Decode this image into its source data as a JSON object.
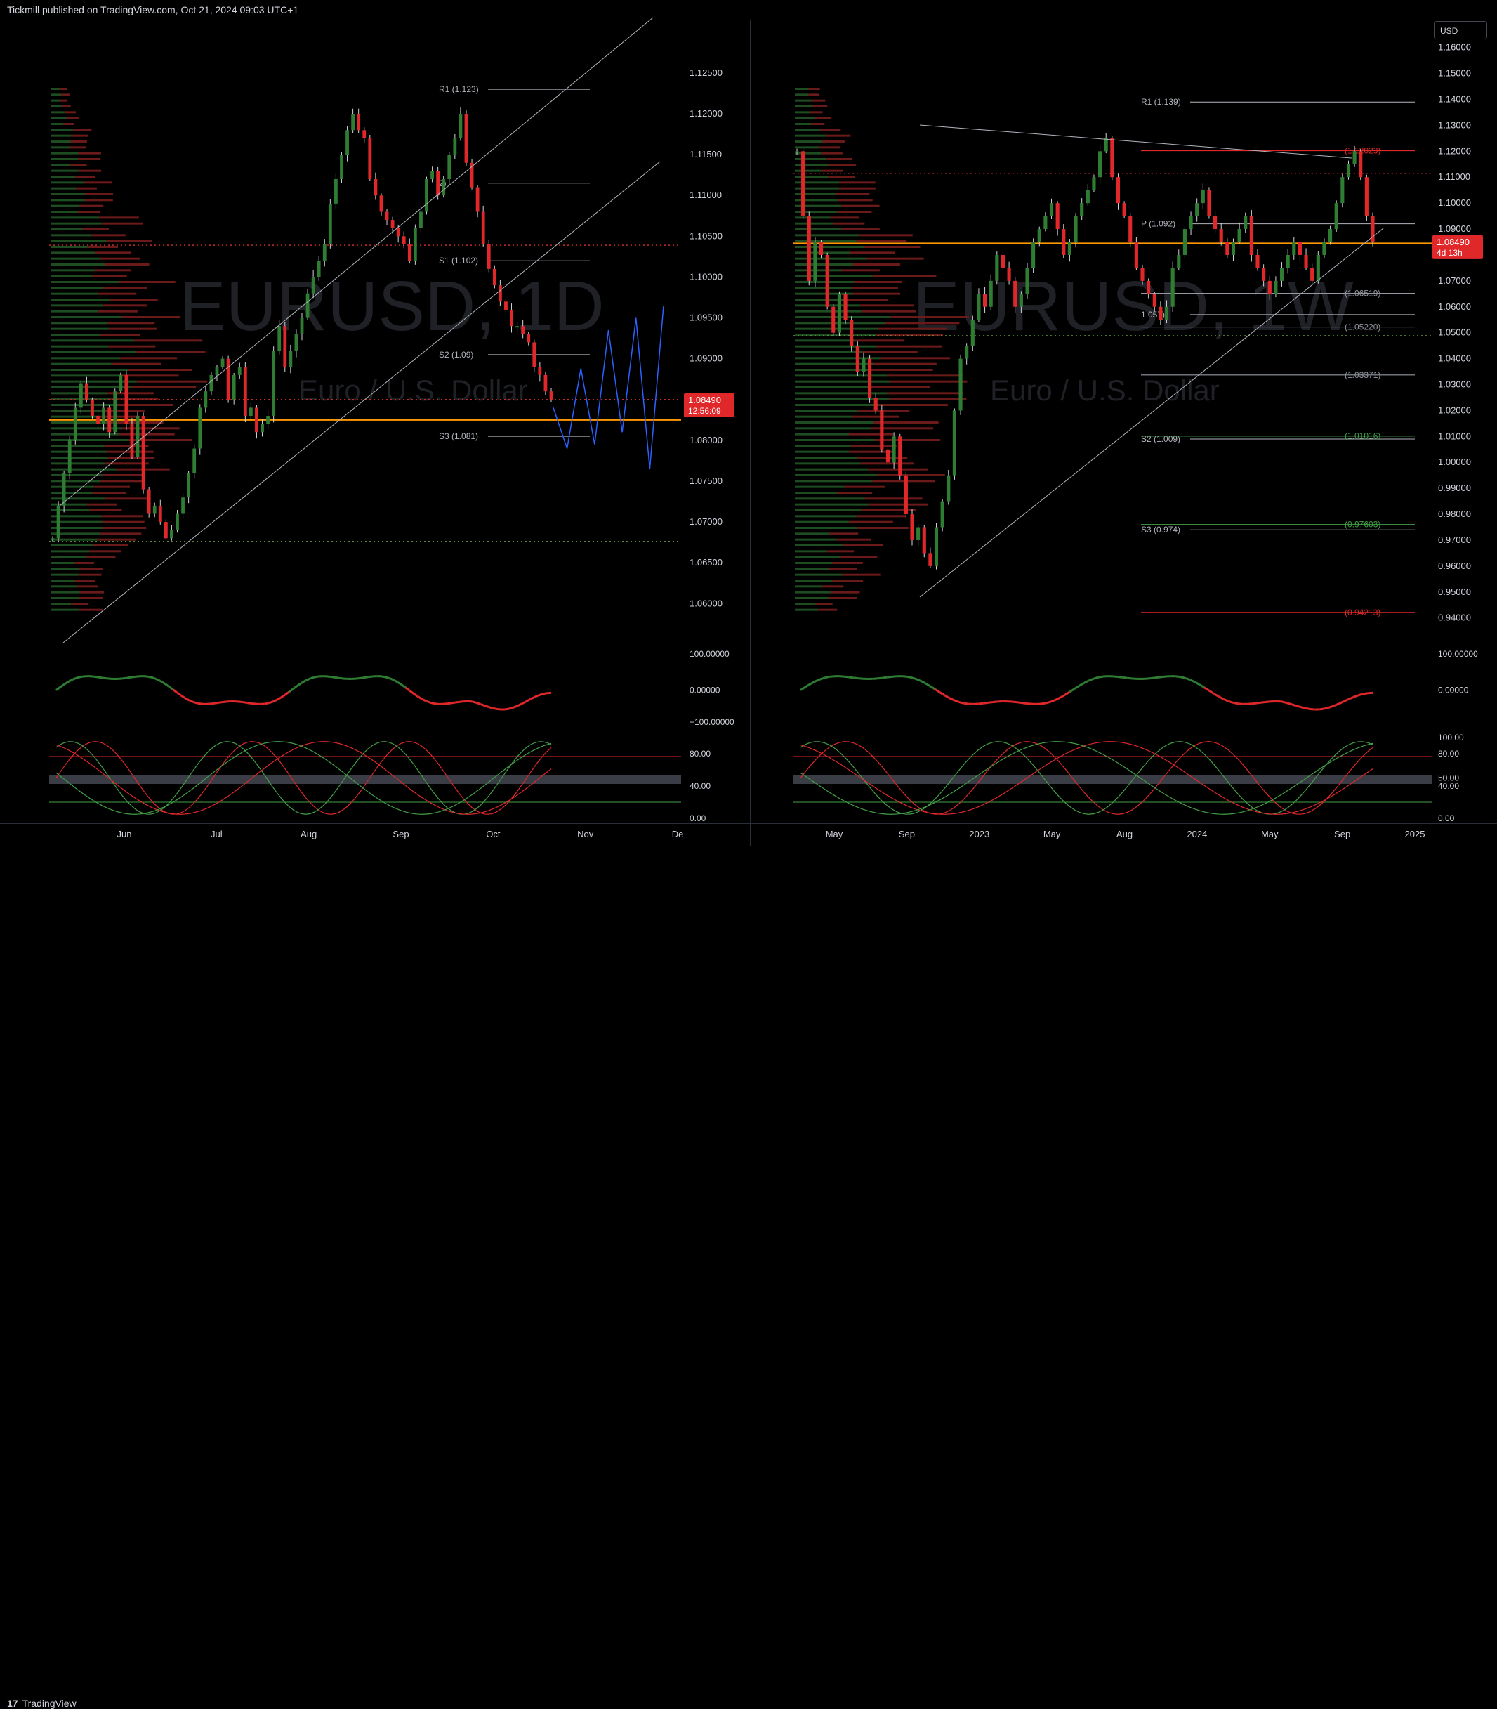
{
  "header": {
    "publisher": "Tickmill published on TradingView.com, Oct 21, 2024 09:03 UTC+1"
  },
  "footer": {
    "brand": "TradingView",
    "brand_mark": "17"
  },
  "currency_selector": "USD",
  "colors": {
    "up": "#2e7d32",
    "down": "#e0282b",
    "orange": "#ff9800",
    "background": "#000000",
    "grid": "#1a1a1a"
  },
  "chart_data": [
    {
      "type": "line",
      "panel": "left",
      "symbol_watermark": "EURUSD, 1D",
      "name_watermark": "Euro / U.S. Dollar",
      "price_axis": [
        "1.12500",
        "1.12000",
        "1.11500",
        "1.11000",
        "1.10500",
        "1.10000",
        "1.09500",
        "1.09000",
        "1.08500",
        "1.08000",
        "1.07500",
        "1.07000",
        "1.06500",
        "1.06000"
      ],
      "ylim": [
        1.0565,
        1.1305
      ],
      "time_axis": [
        "Jun",
        "Jul",
        "Aug",
        "Sep",
        "Oct",
        "Nov",
        "De"
      ],
      "last_price": "1.08490",
      "countdown": "12:56:09",
      "pivot_labels": [
        {
          "label": "R1 (1.123)",
          "value": 1.123
        },
        {
          "label": "2)",
          "value": 1.1115
        },
        {
          "label": "S1 (1.102)",
          "value": 1.102
        },
        {
          "label": "S2 (1.09)",
          "value": 1.0905
        },
        {
          "label": "S3 (1.081)",
          "value": 1.0805
        }
      ],
      "horizontal_lines": {
        "orange": 1.0825,
        "red_dotted": [
          1.1039,
          1.085
        ],
        "green_dotted": 1.0676
      },
      "close_series": [
        1.068,
        1.072,
        1.076,
        1.08,
        1.084,
        1.087,
        1.085,
        1.083,
        1.082,
        1.084,
        1.081,
        1.086,
        1.088,
        1.082,
        1.078,
        1.083,
        1.074,
        1.071,
        1.072,
        1.07,
        1.068,
        1.069,
        1.071,
        1.073,
        1.076,
        1.079,
        1.084,
        1.086,
        1.088,
        1.089,
        1.09,
        1.085,
        1.088,
        1.089,
        1.083,
        1.084,
        1.081,
        1.082,
        1.083,
        1.091,
        1.094,
        1.089,
        1.091,
        1.093,
        1.095,
        1.098,
        1.1,
        1.102,
        1.104,
        1.109,
        1.112,
        1.115,
        1.118,
        1.12,
        1.118,
        1.117,
        1.112,
        1.11,
        1.108,
        1.107,
        1.106,
        1.105,
        1.104,
        1.102,
        1.106,
        1.108,
        1.112,
        1.113,
        1.11,
        1.112,
        1.115,
        1.117,
        1.12,
        1.114,
        1.111,
        1.108,
        1.104,
        1.101,
        1.099,
        1.097,
        1.096,
        1.094,
        1.094,
        1.093,
        1.092,
        1.089,
        1.088,
        1.086,
        1.085
      ],
      "projection_path": [
        1.084,
        1.079,
        1.0888,
        1.0795,
        1.0935,
        1.081,
        1.095,
        1.0765,
        1.0965
      ],
      "oscillator_axis": [
        "100.00000",
        "0.00000",
        "−100.00000"
      ],
      "stoch_axis": [
        "80.00",
        "40.00",
        "0.00"
      ]
    },
    {
      "type": "line",
      "panel": "right",
      "symbol_watermark": "EURUSD, 1W",
      "name_watermark": "Euro / U.S. Dollar",
      "price_axis": [
        "1.16000",
        "1.15000",
        "1.14000",
        "1.13000",
        "1.12000",
        "1.11000",
        "1.10000",
        "1.09000",
        "1.08000",
        "1.07000",
        "1.06000",
        "1.05000",
        "1.04000",
        "1.03000",
        "1.02000",
        "1.01000",
        "1.00000",
        "0.99000",
        "0.98000",
        "0.97000",
        "0.96000",
        "0.95000",
        "0.94000"
      ],
      "ylim": [
        0.9345,
        1.1675
      ],
      "time_axis": [
        "May",
        "Sep",
        "2023",
        "May",
        "Aug",
        "2024",
        "May",
        "Sep",
        "2025"
      ],
      "last_price": "1.08490",
      "countdown": "4d 13h",
      "pivot_labels": [
        {
          "label": "R1 (1.139)",
          "value": 1.139
        },
        {
          "label": "P (1.092)",
          "value": 1.092
        },
        {
          "label": "1.057)",
          "value": 1.057
        },
        {
          "label": "S2 (1.009)",
          "value": 1.009
        },
        {
          "label": "S3 (0.974)",
          "value": 0.974
        }
      ],
      "fib_labels": [
        {
          "label": "(1.12023)",
          "value": 1.12023
        },
        {
          "label": "(1.06519)",
          "value": 1.06519
        },
        {
          "label": "(1.05220)",
          "value": 1.0522
        },
        {
          "label": "(1.03371)",
          "value": 1.03371
        },
        {
          "label": "(1.01016)",
          "value": 1.01016
        },
        {
          "label": "(0.97603)",
          "value": 0.97603
        },
        {
          "label": "(0.94213)",
          "value": 0.94213
        }
      ],
      "horizontal_lines": {
        "orange": 1.0845,
        "red_dotted": 1.1115,
        "green_dotted": 1.0488
      },
      "close_series": [
        1.12,
        1.095,
        1.07,
        1.085,
        1.08,
        1.06,
        1.05,
        1.065,
        1.055,
        1.045,
        1.035,
        1.04,
        1.025,
        1.02,
        1.005,
        1.0,
        1.01,
        0.995,
        0.98,
        0.97,
        0.975,
        0.965,
        0.96,
        0.975,
        0.985,
        0.995,
        1.02,
        1.04,
        1.045,
        1.055,
        1.065,
        1.06,
        1.07,
        1.08,
        1.075,
        1.07,
        1.06,
        1.065,
        1.075,
        1.085,
        1.09,
        1.095,
        1.1,
        1.09,
        1.08,
        1.085,
        1.095,
        1.1,
        1.105,
        1.11,
        1.12,
        1.125,
        1.11,
        1.1,
        1.095,
        1.085,
        1.075,
        1.07,
        1.065,
        1.06,
        1.055,
        1.06,
        1.075,
        1.08,
        1.09,
        1.095,
        1.1,
        1.105,
        1.095,
        1.09,
        1.085,
        1.08,
        1.085,
        1.09,
        1.095,
        1.08,
        1.075,
        1.07,
        1.065,
        1.07,
        1.075,
        1.08,
        1.085,
        1.08,
        1.075,
        1.07,
        1.08,
        1.085,
        1.09,
        1.1,
        1.11,
        1.115,
        1.12,
        1.11,
        1.095,
        1.085
      ],
      "oscillator_axis": [
        "100.00000",
        "0.00000"
      ],
      "stoch_axis": [
        "100.00",
        "80.00",
        "50.00",
        "40.00",
        "0.00"
      ]
    }
  ]
}
